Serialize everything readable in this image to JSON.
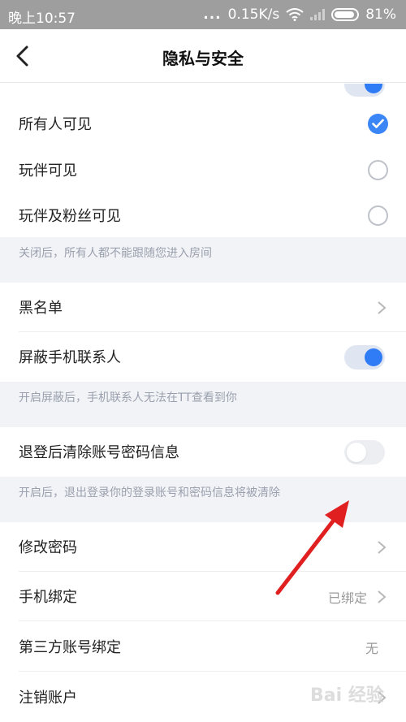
{
  "status_bar": {
    "time": "晚上10:57",
    "dots": "...",
    "speed": "0.15K/s",
    "battery": "81%"
  },
  "nav": {
    "title": "隐私与安全"
  },
  "follow_section": {
    "options": [
      {
        "label": "所有人可见",
        "selected": true
      },
      {
        "label": "玩伴可见",
        "selected": false
      },
      {
        "label": "玩伴及粉丝可见",
        "selected": false
      }
    ],
    "hint": "关闭后，所有人都不能跟随您进入房间"
  },
  "contacts_section": {
    "blacklist_label": "黑名单",
    "block_contacts_label": "屏蔽手机联系人",
    "block_contacts_on": true,
    "hint": "开启屏蔽后，手机联系人无法在TT查看到你"
  },
  "logout_section": {
    "clear_label": "退登后清除账号密码信息",
    "clear_on": false,
    "hint": "开启后，退出登录你的登录账号和密码信息将被清除"
  },
  "account_section": {
    "change_password_label": "修改密码",
    "phone_binding_label": "手机绑定",
    "phone_binding_value": "已绑定",
    "third_party_label": "第三方账号绑定",
    "third_party_value": "无",
    "cancel_account_label": "注销账户"
  },
  "watermark": "Bai 经验",
  "colors": {
    "accent": "#3a86f7",
    "hint_bg": "#f2f3f7",
    "annotation": "#e02020"
  }
}
